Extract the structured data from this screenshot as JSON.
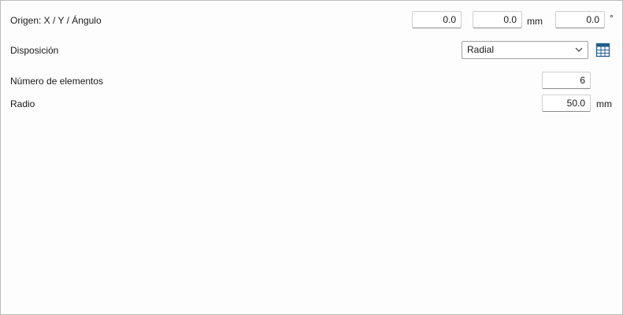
{
  "origin": {
    "label": "Origen: X / Y / Ángulo",
    "x": "0.0",
    "y": "0.0",
    "xy_unit": "mm",
    "angle": "0.0",
    "angle_unit": "°"
  },
  "layout": {
    "label": "Disposición",
    "selected": "Radial",
    "table_icon": "table-icon"
  },
  "elements": {
    "label": "Número de elementos",
    "value": "6"
  },
  "radius": {
    "label": "Radio",
    "value": "50.0",
    "unit": "mm"
  },
  "colors": {
    "accent": "#1f5f8b",
    "border": "#bdbdbd"
  }
}
